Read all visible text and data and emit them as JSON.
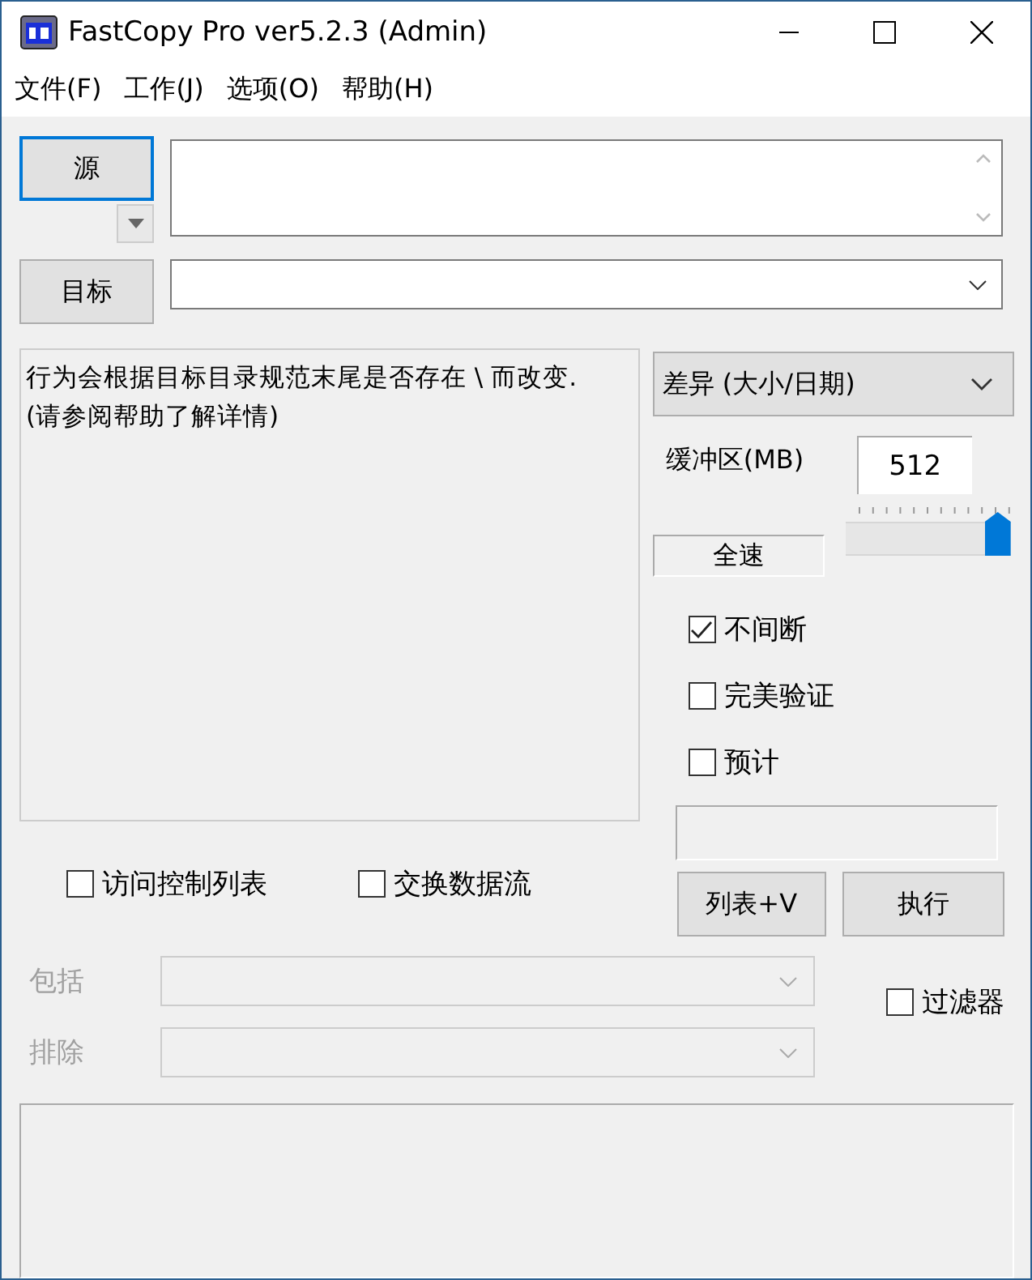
{
  "window": {
    "title": "FastCopy Pro ver5.2.3 (Admin)"
  },
  "menu": [
    {
      "label": "文件(F)"
    },
    {
      "label": "工作(J)"
    },
    {
      "label": "选项(O)"
    },
    {
      "label": "帮助(H)"
    }
  ],
  "source": {
    "button": "源",
    "focused": true
  },
  "target": {
    "button": "目标"
  },
  "info_lines": [
    "行为会根据目标目录规范末尾是否存在 \\ 而改变.",
    "(请参阅帮助了解详情)"
  ],
  "mode": {
    "value": "差异 (大小/日期)"
  },
  "buffer": {
    "label": "缓冲区(MB)",
    "value": "512"
  },
  "speed": {
    "label": "全速",
    "level": 1
  },
  "options": [
    {
      "label": "不间断",
      "checked": true
    },
    {
      "label": "完美验证",
      "checked": false
    },
    {
      "label": "预计",
      "checked": false
    }
  ],
  "actions": [
    {
      "label": "列表+V"
    },
    {
      "label": "执行"
    }
  ],
  "extra_options": [
    {
      "label": "访问控制列表",
      "checked": false
    },
    {
      "label": "交换数据流",
      "checked": false
    }
  ],
  "filters": [
    {
      "label": "包括",
      "disabled": true
    },
    {
      "label": "排除",
      "disabled": true
    }
  ],
  "filter_toggle": {
    "label": "过滤器",
    "checked": false
  }
}
